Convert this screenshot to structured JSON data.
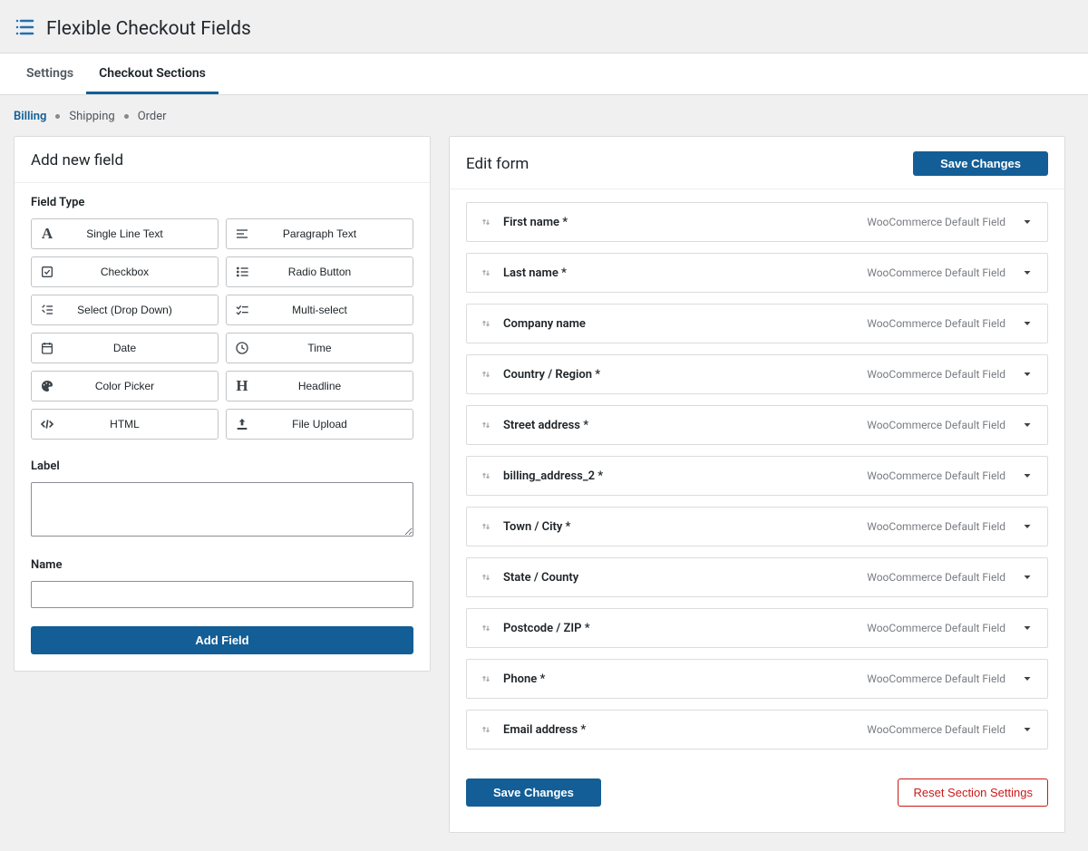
{
  "header": {
    "title": "Flexible Checkout Fields"
  },
  "tabs": {
    "items": [
      {
        "label": "Settings",
        "active": false
      },
      {
        "label": "Checkout Sections",
        "active": true
      }
    ]
  },
  "subnav": {
    "items": [
      {
        "label": "Billing",
        "active": true
      },
      {
        "label": "Shipping",
        "active": false
      },
      {
        "label": "Order",
        "active": false
      }
    ]
  },
  "addPanel": {
    "title": "Add new field",
    "fieldTypeLabel": "Field Type",
    "types": [
      {
        "icon": "text-icon",
        "label": "Single Line Text"
      },
      {
        "icon": "paragraph-icon",
        "label": "Paragraph Text"
      },
      {
        "icon": "checkbox-icon",
        "label": "Checkbox"
      },
      {
        "icon": "radio-icon",
        "label": "Radio Button"
      },
      {
        "icon": "select-icon",
        "label": "Select (Drop Down)"
      },
      {
        "icon": "multiselect-icon",
        "label": "Multi-select"
      },
      {
        "icon": "date-icon",
        "label": "Date"
      },
      {
        "icon": "time-icon",
        "label": "Time"
      },
      {
        "icon": "color-icon",
        "label": "Color Picker"
      },
      {
        "icon": "headline-icon",
        "label": "Headline"
      },
      {
        "icon": "html-icon",
        "label": "HTML"
      },
      {
        "icon": "upload-icon",
        "label": "File Upload"
      }
    ],
    "labelLabel": "Label",
    "labelValue": "",
    "nameLabel": "Name",
    "nameValue": "",
    "addButton": "Add Field"
  },
  "editPanel": {
    "title": "Edit form",
    "saveButton": "Save Changes",
    "badge": "WooCommerce Default Field",
    "fields": [
      {
        "label": "First name *"
      },
      {
        "label": "Last name *"
      },
      {
        "label": "Company name"
      },
      {
        "label": "Country / Region *"
      },
      {
        "label": "Street address *"
      },
      {
        "label": "billing_address_2 *"
      },
      {
        "label": "Town / City *"
      },
      {
        "label": "State / County"
      },
      {
        "label": "Postcode / ZIP *"
      },
      {
        "label": "Phone *"
      },
      {
        "label": "Email address *"
      }
    ],
    "footerSave": "Save Changes",
    "resetButton": "Reset Section Settings"
  }
}
